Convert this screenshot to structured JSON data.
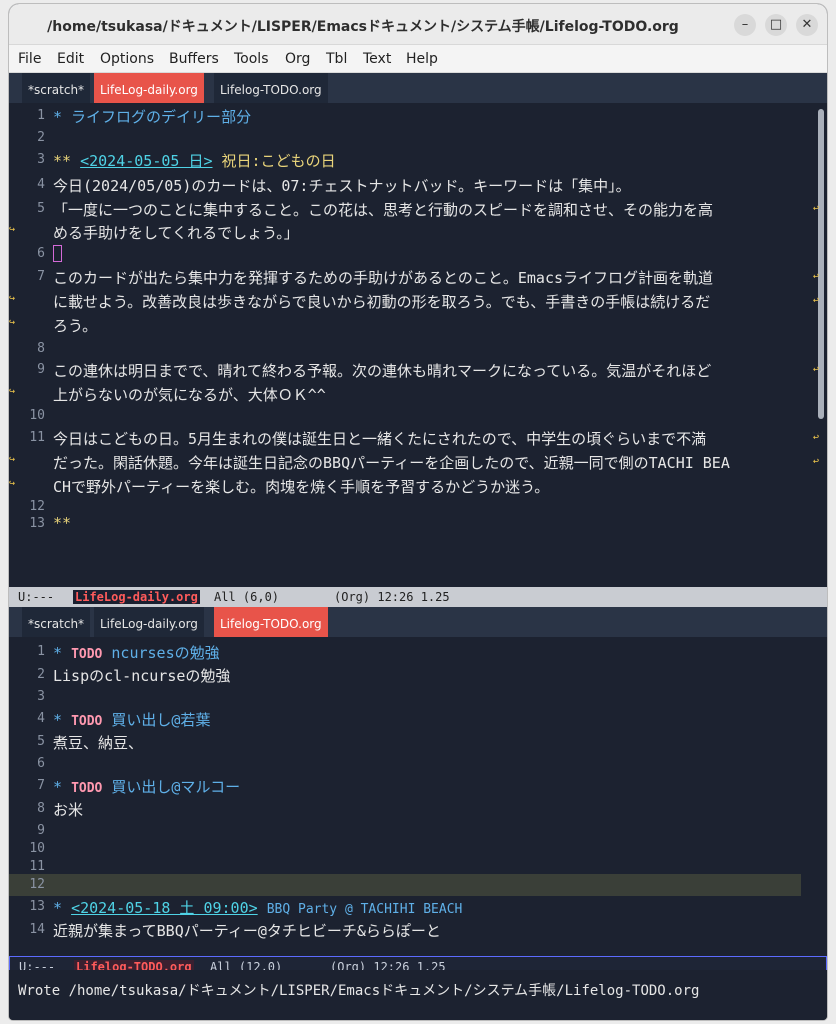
{
  "window": {
    "title": "/home/tsukasa/ドキュメント/LISPER/Emacsドキュメント/システム手帳/Lifelog-TODO.org",
    "minimize": "–",
    "maximize": "□",
    "close": "✕"
  },
  "menu": [
    "File",
    "Edit",
    "Options",
    "Buffers",
    "Tools",
    "Org",
    "Tbl",
    "Text",
    "Help"
  ],
  "top_tabs": [
    "*scratch*",
    "LifeLog-daily.org",
    "Lifelog-TODO.org"
  ],
  "bottom_tabs": [
    "*scratch*",
    "LifeLog-daily.org",
    "Lifelog-TODO.org"
  ],
  "top_pane": {
    "lines": [
      {
        "n": "1",
        "text": "* ライフログのデイリー部分"
      },
      {
        "n": "2",
        "text": ""
      },
      {
        "n": "3",
        "stars": "**",
        "date": "<2024-05-05 日>",
        "holiday": "祝日:こどもの日"
      },
      {
        "n": "4",
        "text": "今日(2024/05/05)のカードは、07:チェストナットバッド。キーワードは「集中」。"
      },
      {
        "n": "5",
        "text": "「一度に一つのことに集中すること。この花は、思考と行動のスピードを調和させ、その能力を高"
      },
      {
        "n": "",
        "text": "める手助けをしてくれるでしょう。」"
      },
      {
        "n": "6",
        "text": ""
      },
      {
        "n": "7",
        "text": "このカードが出たら集中力を発揮するための手助けがあるとのこと。Emacsライフログ計画を軌道"
      },
      {
        "n": "",
        "text": "に載せよう。改善改良は歩きながらで良いから初動の形を取ろう。でも、手書きの手帳は続けるだ"
      },
      {
        "n": "",
        "text": "ろう。"
      },
      {
        "n": "8",
        "text": ""
      },
      {
        "n": "9",
        "text": "この連休は明日までで、晴れて終わる予報。次の連休も晴れマークになっている。気温がそれほど"
      },
      {
        "n": "",
        "text": "上がらないのが気になるが、大体ＯＫ^^"
      },
      {
        "n": "10",
        "text": ""
      },
      {
        "n": "11",
        "text": "今日はこどもの日。5月生まれの僕は誕生日と一緒くたにされたので、中学生の頃ぐらいまで不満"
      },
      {
        "n": "",
        "text": "だった。閑話休題。今年は誕生日記念のBBQパーティーを企画したので、近親一同で側のTACHI BEA"
      },
      {
        "n": "",
        "text": "CHで野外パーティーを楽しむ。肉塊を焼く手順を予習するかどうか迷う。"
      },
      {
        "n": "12",
        "text": ""
      },
      {
        "n": "13",
        "text": "**"
      }
    ],
    "modeline": {
      "state": "U:---",
      "buffer": "LifeLog-daily.org",
      "pos": "All (6,0)",
      "mode": "(Org) 12:26 1.25"
    }
  },
  "bottom_pane": {
    "lines": [
      {
        "n": "1",
        "star": "*",
        "todo": "TODO",
        "head": "ncursesの勉強"
      },
      {
        "n": "2",
        "text": "Lispのcl-ncurseの勉強"
      },
      {
        "n": "3",
        "text": ""
      },
      {
        "n": "4",
        "star": "*",
        "todo": "TODO",
        "head": "買い出し@若葉"
      },
      {
        "n": "5",
        "text": "煮豆、納豆、"
      },
      {
        "n": "6",
        "text": ""
      },
      {
        "n": "7",
        "star": "*",
        "todo": "TODO",
        "head": "買い出し@マルコー"
      },
      {
        "n": "8",
        "text": "お米"
      },
      {
        "n": "9",
        "text": ""
      },
      {
        "n": "10",
        "text": ""
      },
      {
        "n": "11",
        "text": ""
      },
      {
        "n": "12",
        "text": ""
      },
      {
        "n": "13",
        "star": "*",
        "date": "<2024-05-18 土 09:00>",
        "head": "BBQ Party @ TACHIHI BEACH"
      },
      {
        "n": "14",
        "text": "近親が集まってBBQパーティー@タチヒビーチ&ららぽーと"
      }
    ],
    "modeline": {
      "state": "U:---",
      "buffer": "Lifelog-TODO.org",
      "pos": "All (12,0)",
      "mode": "(Org) 12:26 1.25"
    }
  },
  "echo": "Wrote /home/tsukasa/ドキュメント/LISPER/Emacsドキュメント/システム手帳/Lifelog-TODO.org"
}
